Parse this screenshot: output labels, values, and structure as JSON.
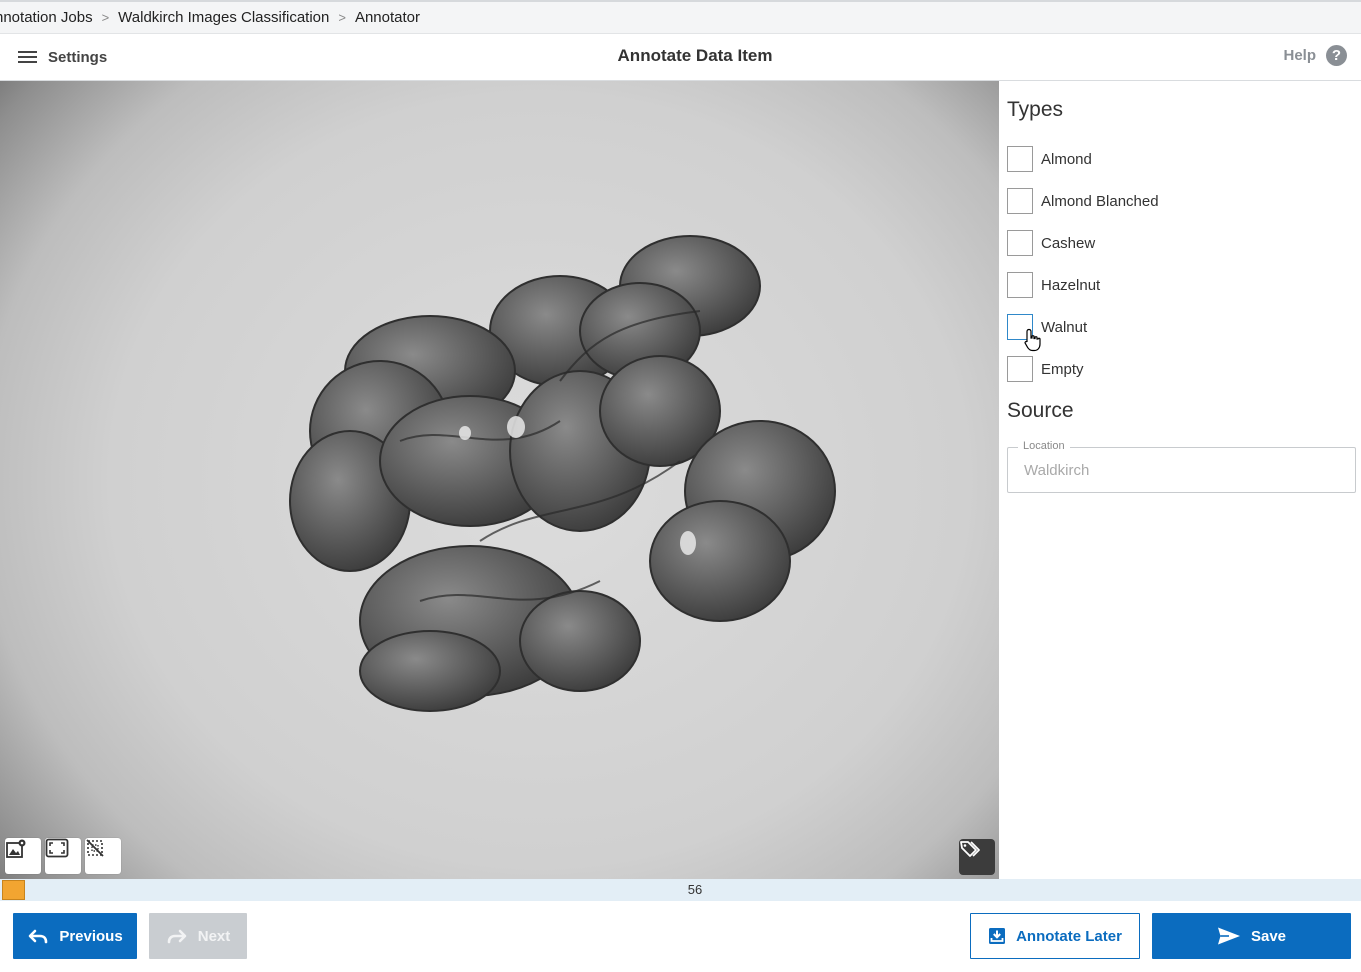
{
  "breadcrumb": {
    "items": [
      "nnotation Jobs",
      "Waldkirch Images Classification",
      "Annotator"
    ],
    "separator": ">"
  },
  "header": {
    "menu_label": "Settings",
    "title": "Annotate Data Item",
    "help_label": "Help",
    "help_icon_glyph": "?"
  },
  "viewer": {
    "tools": [
      "image-settings-icon",
      "fit-to-screen-icon",
      "hide-annotations-icon"
    ],
    "tag_icon": "tag-icon"
  },
  "sidebar": {
    "types_title": "Types",
    "types": [
      {
        "label": "Almond",
        "checked": false
      },
      {
        "label": "Almond Blanched",
        "checked": false
      },
      {
        "label": "Cashew",
        "checked": false
      },
      {
        "label": "Hazelnut",
        "checked": false
      },
      {
        "label": "Walnut",
        "checked": false,
        "hovered": true
      },
      {
        "label": "Empty",
        "checked": false
      }
    ],
    "source_title": "Source",
    "location": {
      "label": "Location",
      "value": "Waldkirch"
    }
  },
  "progress": {
    "current": "56",
    "marker_color": "#f2a531"
  },
  "footer": {
    "previous_label": "Previous",
    "next_label": "Next",
    "annotate_later_label": "Annotate Later",
    "save_label": "Save"
  },
  "colors": {
    "primary": "#0b6cbf",
    "disabled": "#c9cdd1",
    "accent": "#f2a531"
  }
}
